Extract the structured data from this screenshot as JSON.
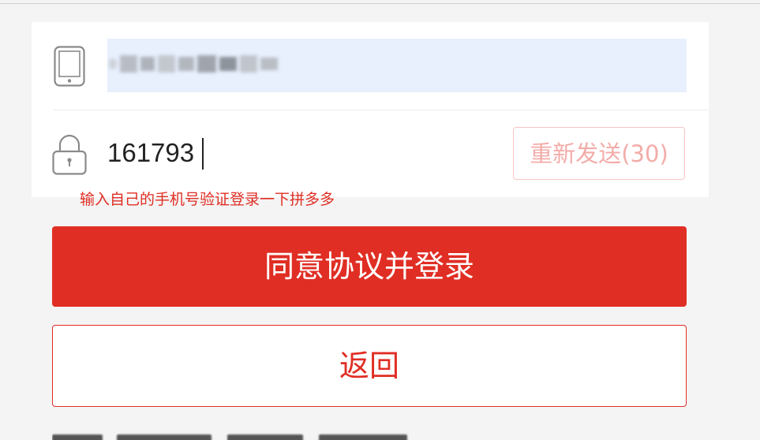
{
  "form": {
    "phone_value": "",
    "code_value": "161793",
    "resend_label": "重新发送(30)"
  },
  "hint": {
    "text": "输入自己的手机号验证登录一下拼多多"
  },
  "buttons": {
    "login_label": "同意协议并登录",
    "back_label": "返回"
  },
  "icons": {
    "phone": "phone-icon",
    "lock": "lock-icon"
  },
  "colors": {
    "accent": "#e02e24",
    "accent_light": "#f3aca8",
    "autofill_bg": "#e8f0fe",
    "page_bg": "#f4f4f4"
  }
}
